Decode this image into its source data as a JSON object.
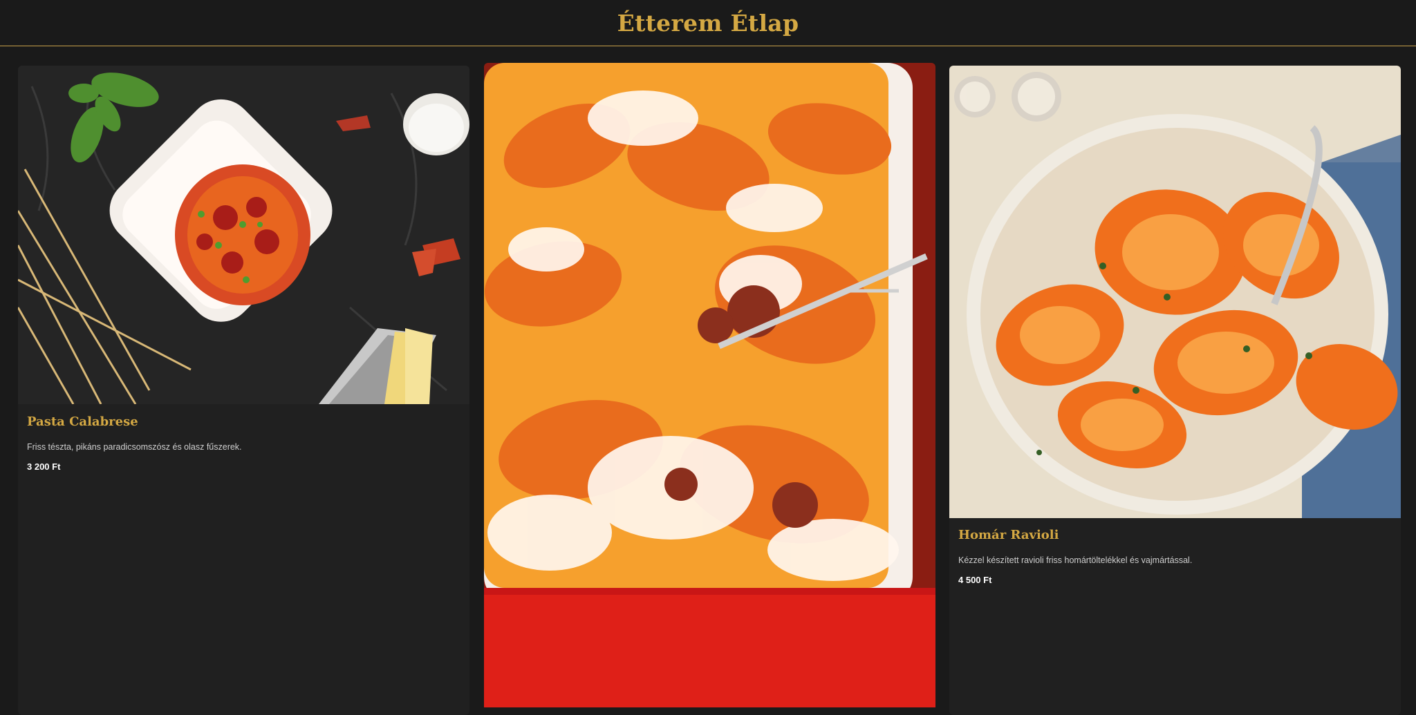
{
  "header": {
    "title": "Étterem Étlap"
  },
  "menu": {
    "items": [
      {
        "name": "Pasta Calabrese",
        "description": "Friss tészta, pikáns paradicsomszósz és olasz fűszerek.",
        "price": "3 200 Ft",
        "image": "spaghetti-bowl-photo"
      },
      {
        "image": "baked-rigatoni-photo"
      },
      {
        "name": "Homár Ravioli",
        "description": "Kézzel készített ravioli friss homártöltelékkel és vajmártással.",
        "price": "4 500 Ft",
        "image": "ravioli-plate-photo"
      }
    ]
  },
  "colors": {
    "background": "#1a1a1a",
    "card": "#202020",
    "accent": "#d4a843",
    "text": "#cfcfcf"
  }
}
